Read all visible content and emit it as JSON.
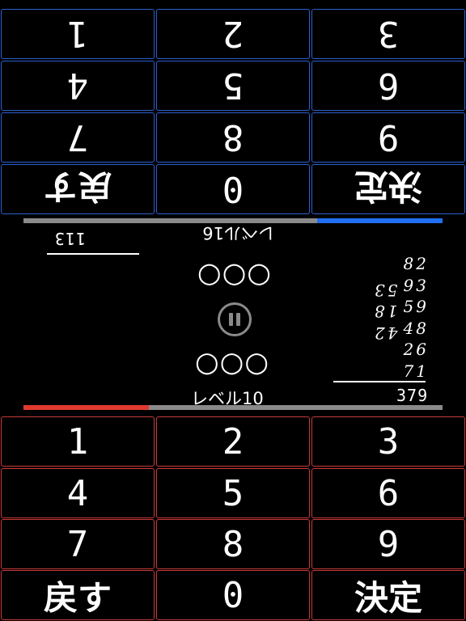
{
  "player2": {
    "keypad": [
      {
        "label": "決定"
      },
      {
        "label": "0"
      },
      {
        "label": "戻す"
      },
      {
        "label": "9"
      },
      {
        "label": "8"
      },
      {
        "label": "7"
      },
      {
        "label": "6"
      },
      {
        "label": "5"
      },
      {
        "label": "4"
      },
      {
        "label": "3"
      },
      {
        "label": "2"
      },
      {
        "label": "1"
      }
    ],
    "timer_progress": 0.3,
    "answer": "113",
    "numbers": [
      "42",
      "18",
      "53"
    ],
    "level": "レベル16",
    "circles": "○○○"
  },
  "player1": {
    "keypad": [
      {
        "label": "1"
      },
      {
        "label": "2"
      },
      {
        "label": "3"
      },
      {
        "label": "4"
      },
      {
        "label": "5"
      },
      {
        "label": "6"
      },
      {
        "label": "7"
      },
      {
        "label": "8"
      },
      {
        "label": "9"
      },
      {
        "label": "戻す"
      },
      {
        "label": "0"
      },
      {
        "label": "決定"
      }
    ],
    "timer_progress": 0.3,
    "numbers": [
      "82",
      "93",
      "59",
      "48",
      "26",
      "71"
    ],
    "answer": "379",
    "level": "レベル10",
    "circles": "○○○"
  },
  "pause_icon": "pause-icon",
  "colors": {
    "player2_accent": "#2d5fd0",
    "player1_accent": "#c83a3a",
    "timer_blue": "#1f6ff0",
    "timer_red": "#e03a2e",
    "track": "#8a8a8a"
  }
}
